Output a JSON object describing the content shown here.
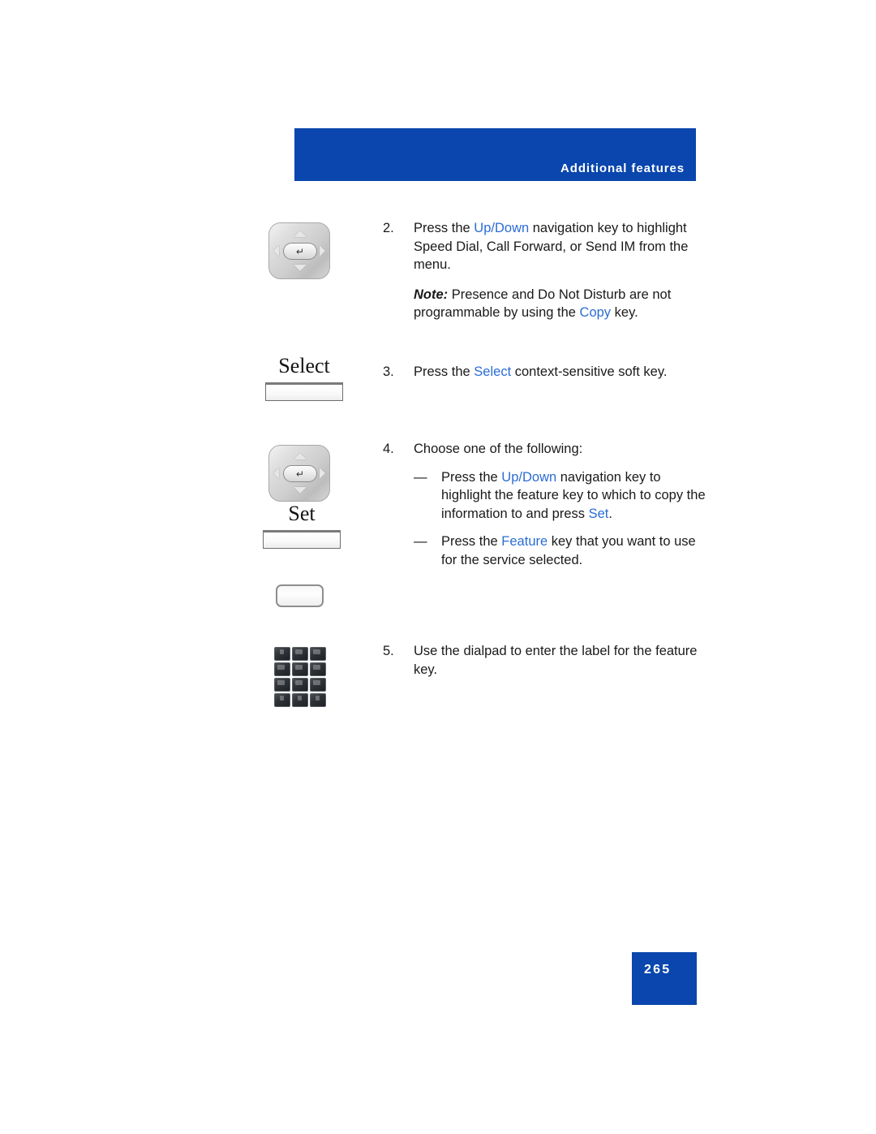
{
  "header": {
    "title": "Additional features"
  },
  "footer": {
    "page_number": "265"
  },
  "colors": {
    "brand_blue": "#0a46ad",
    "keyword_blue": "#2b6cd4",
    "body_text": "#1a1a1a"
  },
  "gutter_art": {
    "nav_key_1": {
      "icon": "navigation-key-icon",
      "enter_glyph": "↵"
    },
    "select_softkey": {
      "label": "Select",
      "icon": "soft-key-icon"
    },
    "nav_key_2": {
      "icon": "navigation-key-icon",
      "enter_glyph": "↵"
    },
    "set_softkey": {
      "label": "Set",
      "icon": "soft-key-icon"
    },
    "feature_key": {
      "label": "",
      "icon": "feature-key-icon"
    },
    "dialpad": {
      "icon": "dialpad-icon",
      "rows": 4,
      "cols": 3
    }
  },
  "steps": [
    {
      "number": "2.",
      "segments": [
        {
          "text": "Press the ",
          "style": "plain"
        },
        {
          "text": "Up/Down",
          "style": "keyword"
        },
        {
          "text": " navigation key to highlight Speed Dial, Call Forward, or Send IM from the menu.",
          "style": "plain"
        }
      ],
      "note": {
        "label": "Note:",
        "segments": [
          {
            "text": " Presence and Do Not Disturb are not programmable by using the ",
            "style": "plain"
          },
          {
            "text": "Copy",
            "style": "keyword"
          },
          {
            "text": " key.",
            "style": "plain"
          }
        ]
      }
    },
    {
      "number": "3.",
      "segments": [
        {
          "text": "Press the ",
          "style": "plain"
        },
        {
          "text": "Select",
          "style": "keyword"
        },
        {
          "text": " context-sensitive soft key.",
          "style": "plain"
        }
      ]
    },
    {
      "number": "4.",
      "segments": [
        {
          "text": "Choose one of the following:",
          "style": "plain"
        }
      ],
      "bullets": [
        {
          "mark": "—",
          "segments": [
            {
              "text": "Press the ",
              "style": "plain"
            },
            {
              "text": "Up/Down",
              "style": "keyword"
            },
            {
              "text": " navigation key to highlight the feature key to which to copy the information to and press ",
              "style": "plain"
            },
            {
              "text": "Set",
              "style": "keyword"
            },
            {
              "text": ".",
              "style": "plain"
            }
          ]
        },
        {
          "mark": "—",
          "segments": [
            {
              "text": "Press the ",
              "style": "plain"
            },
            {
              "text": "Feature",
              "style": "keyword"
            },
            {
              "text": " key that you want to use for the service selected.",
              "style": "plain"
            }
          ]
        }
      ]
    },
    {
      "number": "5.",
      "segments": [
        {
          "text": "Use the dialpad to enter the label for the feature key.",
          "style": "plain"
        }
      ]
    }
  ]
}
